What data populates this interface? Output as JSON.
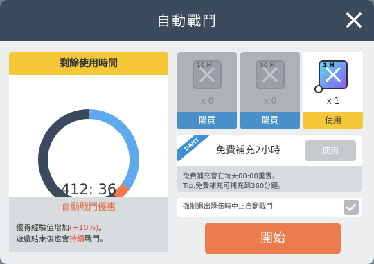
{
  "header": {
    "title": "自動戰鬥"
  },
  "timer": {
    "title": "剩餘使用時間",
    "remaining_text": "412: 36",
    "segments": [
      {
        "name": "remaining",
        "fraction": 0.6,
        "color": "#3b4a5c"
      },
      {
        "name": "normal",
        "fraction": 0.35,
        "color": "#5ea9ef"
      },
      {
        "name": "bonus",
        "fraction": 0.05,
        "color": "#ef7a4f"
      }
    ]
  },
  "promo": {
    "title": "自動戰鬥優惠",
    "line1_prefix": "獲得經驗值增加",
    "line1_highlight": "(+10%)",
    "line1_suffix": "。",
    "line2_prefix": "遊戲結束後也會",
    "line2_highlight": "持續",
    "line2_suffix": "戰鬥。"
  },
  "items": [
    {
      "tag": "10 M",
      "qty": "x 0",
      "action": "購買"
    },
    {
      "tag": "30 M",
      "qty": "x 0",
      "action": "購買"
    },
    {
      "tag": "1 H",
      "qty": "x 1",
      "action": "使用"
    }
  ],
  "daily": {
    "ribbon": "DAILY",
    "title": "免費補充2小時",
    "use_button": "使用",
    "info1": "免費補充會在每天00:00重置。",
    "info2": "Tip.免費補充可補充到360分鐘。"
  },
  "option": {
    "text": "強制退出隊伍時中止自動戰鬥"
  },
  "start_button": "開始"
}
